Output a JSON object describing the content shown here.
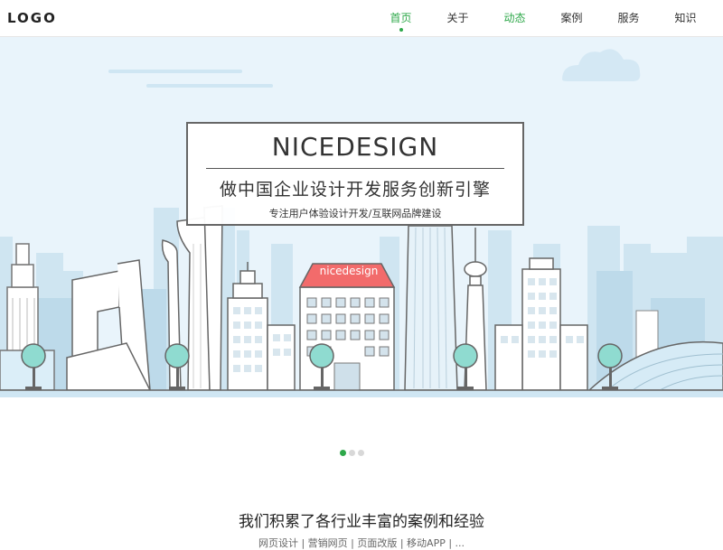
{
  "header": {
    "logo": "LOGO",
    "nav": [
      "首页",
      "关于",
      "动态",
      "案例",
      "服务",
      "知识"
    ]
  },
  "banner": {
    "title_bold": "NICE",
    "title_light": "DESIGN",
    "subtitle": "做中国企业设计开发服务创新引擎",
    "tagline": "专注用户体验设计开发/互联网品牌建设",
    "building_sign": "nicedesign"
  },
  "carousel": {
    "total": 3,
    "active": 1
  },
  "section": {
    "title": "我们积累了各行业丰富的案例和经验",
    "subtitle": "网页设计 | 营销网页 | 页面改版 | 移动APP | ..."
  },
  "colors": {
    "accent": "#2ea84a",
    "sign_red": "#f26b6b",
    "sky": "#e9f4fb"
  }
}
